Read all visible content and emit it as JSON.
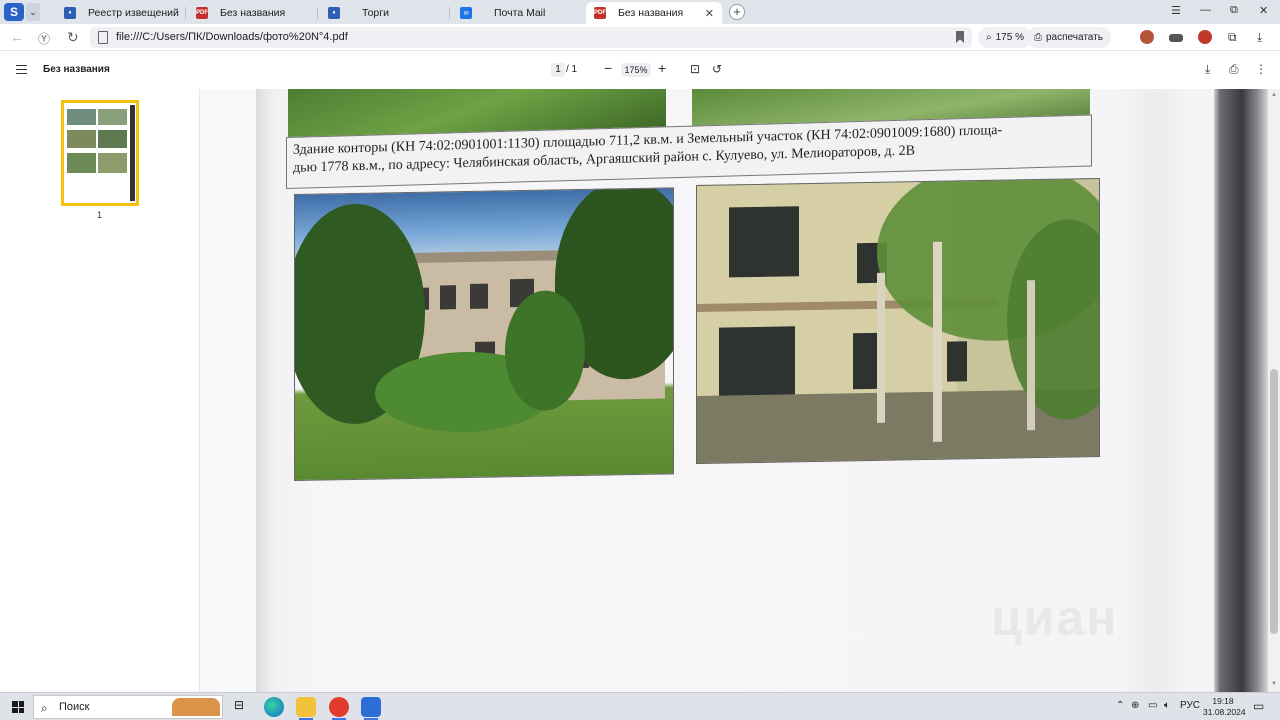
{
  "colors": {
    "tabstrip": "#dfe3ea",
    "accent": "#f4c20d",
    "taskbar": "#dfe2e8"
  },
  "tabs": [
    {
      "label": "Реестр извещений",
      "icon": "gov-icon"
    },
    {
      "label": "Без названия",
      "icon": "pdf-icon"
    },
    {
      "label": "Торги",
      "icon": "gov-icon"
    },
    {
      "label": "Почта Mail",
      "icon": "mail-icon"
    },
    {
      "label": "Без названия",
      "icon": "pdf-icon",
      "active": true
    }
  ],
  "browser": {
    "url": "file:///C:/Users/ПК/Downloads/фото%20N°4.pdf",
    "zoom": "175 %",
    "print_label": "распечатать"
  },
  "pdf": {
    "title": "Без названия",
    "page_current": "1",
    "page_total": "/ 1",
    "zoom": "175%",
    "thumb_label": "1"
  },
  "document": {
    "caption_line1": "Здание конторы (КН 74:02:0901001:1130) площадью 711,2 кв.м. и Земельный участок (КН 74:02:0901009:1680) площа-",
    "caption_line2": "дью 1778  кв.м., по адресу: Челябинская область, Аргаяшский район с. Кулуево, ул. Мелиораторов, д. 2В",
    "watermark": "циан"
  },
  "taskbar": {
    "search_label": "Поиск",
    "lang": "РУС",
    "time": "19:18",
    "date": "31.08.2024"
  }
}
